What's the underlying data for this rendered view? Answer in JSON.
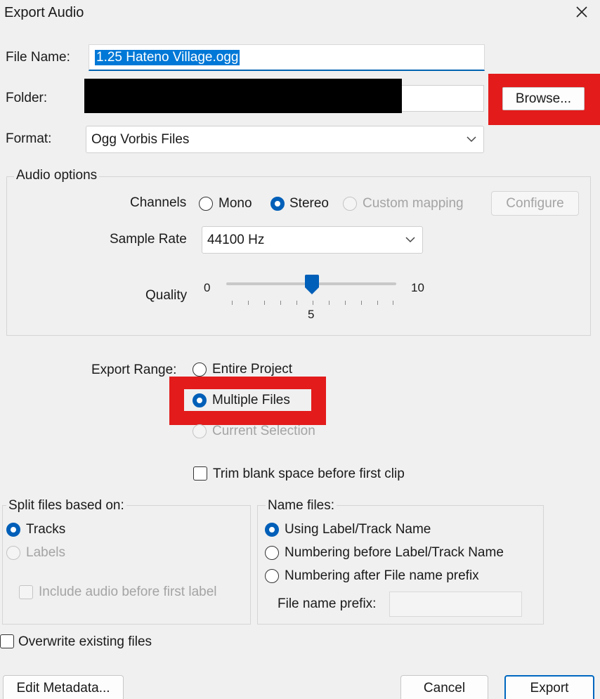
{
  "window": {
    "title": "Export Audio"
  },
  "file": {
    "name_label": "File Name:",
    "name_value": "1.25 Hateno Village.ogg",
    "folder_label": "Folder:",
    "browse_label": "Browse...",
    "format_label": "Format:",
    "format_value": "Ogg Vorbis Files"
  },
  "audio_options": {
    "title": "Audio options",
    "channels_label": "Channels",
    "channels": [
      {
        "label": "Mono",
        "selected": false,
        "enabled": true
      },
      {
        "label": "Stereo",
        "selected": true,
        "enabled": true
      },
      {
        "label": "Custom mapping",
        "selected": false,
        "enabled": false
      }
    ],
    "configure_label": "Configure",
    "sample_rate_label": "Sample Rate",
    "sample_rate_value": "44100 Hz",
    "quality_label": "Quality",
    "quality_min": "0",
    "quality_max": "10",
    "quality_value": "5"
  },
  "export_range": {
    "label": "Export Range:",
    "options": [
      {
        "label": "Entire Project",
        "selected": false,
        "enabled": true
      },
      {
        "label": "Multiple Files",
        "selected": true,
        "enabled": true
      },
      {
        "label": "Current Selection",
        "selected": false,
        "enabled": false
      }
    ],
    "trim_label": "Trim blank space before first clip"
  },
  "split": {
    "title": "Split files based on:",
    "tracks_label": "Tracks",
    "labels_label": "Labels",
    "include_label": "Include audio before first label"
  },
  "naming": {
    "title": "Name files:",
    "options": [
      {
        "label": "Using Label/Track Name",
        "selected": true
      },
      {
        "label": "Numbering before Label/Track Name",
        "selected": false
      },
      {
        "label": "Numbering after File name prefix",
        "selected": false
      }
    ],
    "prefix_label": "File name prefix:"
  },
  "overwrite_label": "Overwrite existing files",
  "buttons": {
    "edit_metadata": "Edit Metadata...",
    "cancel": "Cancel",
    "export": "Export"
  },
  "colors": {
    "highlight": "#e31b1b",
    "accent": "#005fb8",
    "selection": "#0078d7"
  }
}
